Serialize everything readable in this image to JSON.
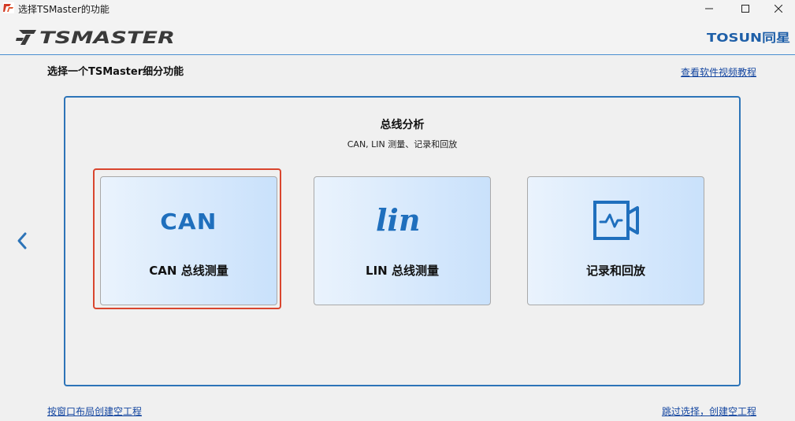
{
  "window": {
    "title": "选择TSMaster的功能",
    "controls": [
      "minimize",
      "maximize",
      "close"
    ]
  },
  "brand": {
    "name": "TSMASTER",
    "vendor": "TOSUN同星",
    "accent_color": "#2d74b8",
    "selection_color": "#d9452e"
  },
  "header": {
    "subtitle": "选择一个TSMaster细分功能",
    "help_link": "查看软件视频教程"
  },
  "panel": {
    "title": "总线分析",
    "description": "CAN, LIN 测量、记录和回放",
    "cards": [
      {
        "label": "CAN 总线测量",
        "icon": "can-logo-icon",
        "icon_text": "CAN",
        "selected": true
      },
      {
        "label": "LIN 总线测量",
        "icon": "lin-logo-icon",
        "icon_text": "lin",
        "selected": false
      },
      {
        "label": "记录和回放",
        "icon": "record-replay-icon",
        "selected": false
      }
    ]
  },
  "footer": {
    "layout_link": "按窗口布局创建空工程",
    "skip_link": "跳过选择，创建空工程"
  }
}
